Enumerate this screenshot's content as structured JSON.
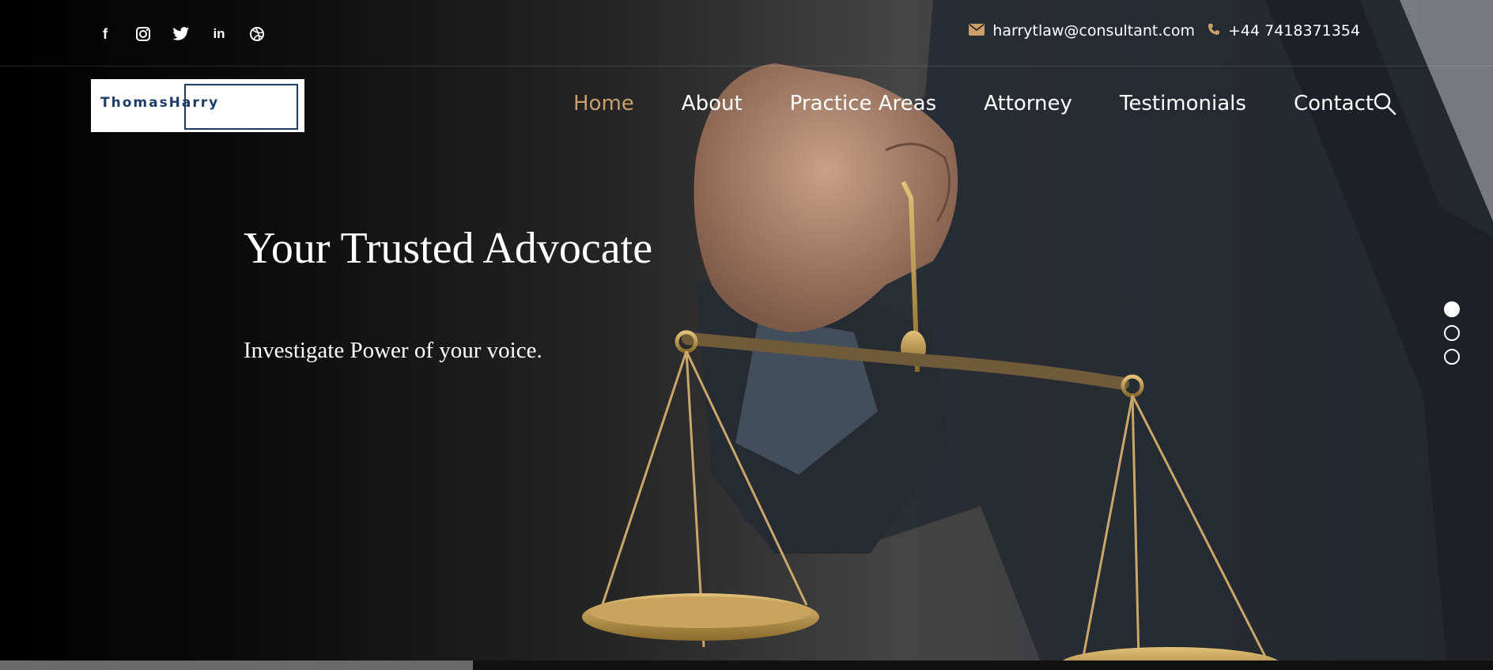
{
  "topbar": {
    "social": [
      {
        "name": "facebook-icon",
        "glyph": "f"
      },
      {
        "name": "instagram-icon",
        "glyph": ""
      },
      {
        "name": "twitter-icon",
        "glyph": ""
      },
      {
        "name": "linkedin-icon",
        "glyph": "in"
      },
      {
        "name": "dribbble-icon",
        "glyph": ""
      }
    ],
    "email": "harrytlaw@consultant.com",
    "phone": "+44 7418371354"
  },
  "logo": {
    "text": "ThomasHarry"
  },
  "nav": {
    "items": [
      "Home",
      "About",
      "Practice Areas",
      "Attorney",
      "Testimonials",
      "Contact"
    ],
    "active_index": 0
  },
  "hero": {
    "title": "Your Trusted Advocate",
    "subtitle": "Investigate Power of your voice."
  },
  "slider": {
    "count": 3,
    "active_index": 0,
    "progress": 0.317
  },
  "colors": {
    "accent": "#c9a06a",
    "logo_blue": "#1d3b6a",
    "text": "#ffffff"
  }
}
